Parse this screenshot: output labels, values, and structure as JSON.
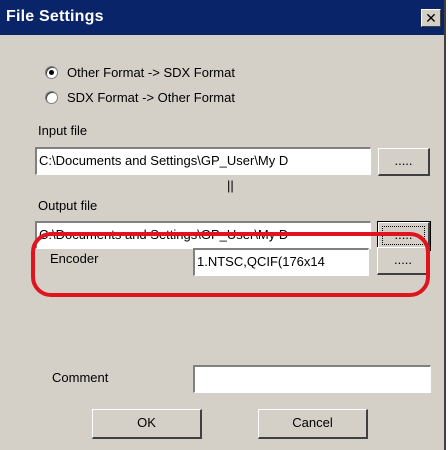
{
  "window": {
    "title": "File Settings",
    "close_glyph": "✕"
  },
  "conversion": {
    "options": [
      {
        "label": "Other Format -> SDX Format",
        "selected": true
      },
      {
        "label": "SDX Format -> Other Format",
        "selected": false
      }
    ]
  },
  "input_file": {
    "label": "Input file",
    "value": "C:\\Documents and Settings\\GP_User\\My D",
    "browse_label": "....."
  },
  "separator_mark": "||",
  "output_file": {
    "label": "Output file",
    "value": "C:\\Documents and Settings\\GP_User\\My D",
    "browse_label": "....."
  },
  "encoder": {
    "label": "Encoder",
    "value": "1.NTSC,QCIF(176x14",
    "browse_label": "....."
  },
  "comment": {
    "label": "Comment",
    "value": ""
  },
  "actions": {
    "ok_label": "OK",
    "cancel_label": "Cancel"
  },
  "colors": {
    "titlebar": "#0a246a",
    "dialog_bg": "#d4d0c8",
    "highlight": "#e0141e"
  }
}
